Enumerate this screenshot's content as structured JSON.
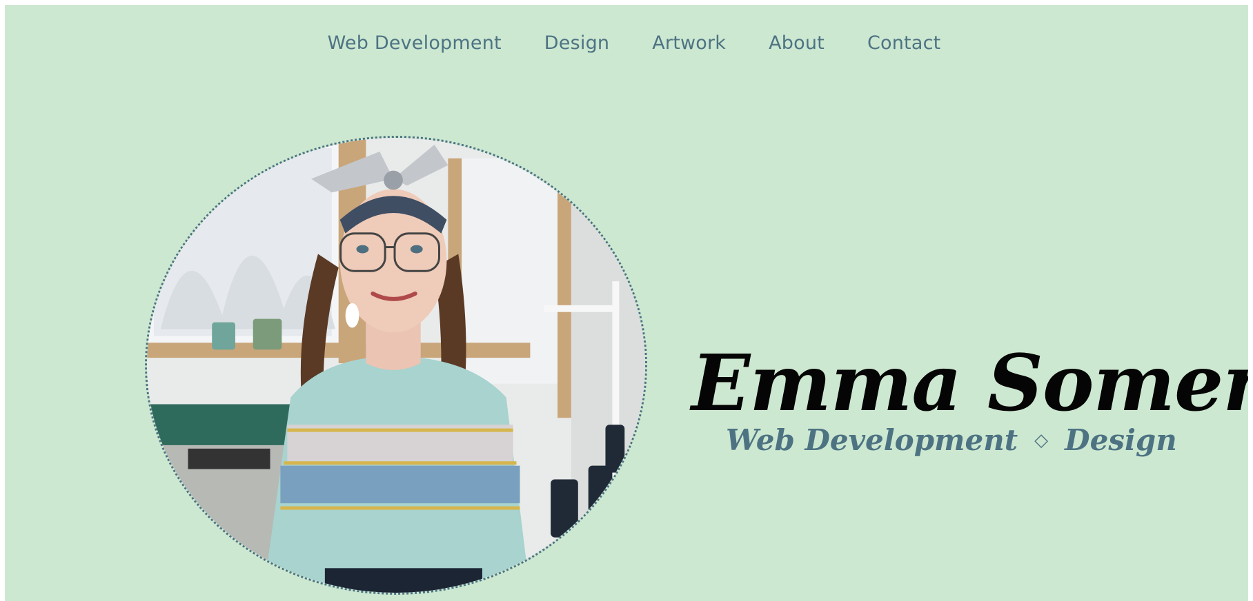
{
  "nav": {
    "items": [
      {
        "label": "Web Development"
      },
      {
        "label": "Design"
      },
      {
        "label": "Artwork"
      },
      {
        "label": "About"
      },
      {
        "label": "Contact"
      }
    ]
  },
  "hero": {
    "name": "Emma Somers",
    "tagline_left": "Web Development",
    "tagline_separator": "◇",
    "tagline_right": "Design"
  },
  "colors": {
    "background": "#cde8d1",
    "accent": "#4d7383",
    "name": "#050505"
  }
}
